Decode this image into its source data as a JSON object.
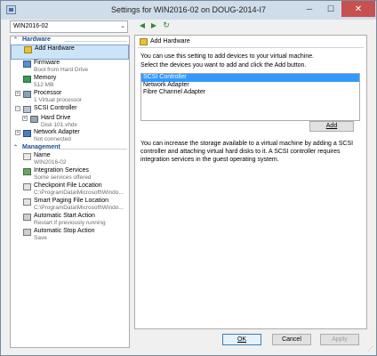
{
  "window": {
    "title": "Settings for WIN2016-02 on DOUG-2014-I7",
    "minimize_glyph": "─",
    "maximize_glyph": "☐",
    "close_glyph": "✕"
  },
  "vm_selector": {
    "value": "WIN2016-02",
    "chevron": "⌄"
  },
  "toolbar": {
    "back_glyph": "◀",
    "forward_glyph": "▶",
    "refresh_glyph": "↻"
  },
  "hardware": {
    "heading": "Hardware",
    "collapse_glyph": "⌃",
    "items": [
      {
        "name": "Add Hardware",
        "detail": ""
      },
      {
        "name": "Firmware",
        "detail": "Boot from Hard Drive"
      },
      {
        "name": "Memory",
        "detail": "512 MB"
      },
      {
        "name": "Processor",
        "detail": "1 Virtual processor"
      },
      {
        "name": "SCSI Controller",
        "detail": ""
      },
      {
        "name": "Hard Drive",
        "detail": "Disk 101.vhdx"
      },
      {
        "name": "Network Adapter",
        "detail": "Not connected"
      }
    ]
  },
  "management": {
    "heading": "Management",
    "collapse_glyph": "⌃",
    "items": [
      {
        "name": "Name",
        "detail": "WIN2016-02"
      },
      {
        "name": "Integration Services",
        "detail": "Some services offered"
      },
      {
        "name": "Checkpoint File Location",
        "detail": "C:\\ProgramData\\Microsoft\\Windo..."
      },
      {
        "name": "Smart Paging File Location",
        "detail": "C:\\ProgramData\\Microsoft\\Windo..."
      },
      {
        "name": "Automatic Start Action",
        "detail": "Restart if previously running"
      },
      {
        "name": "Automatic Stop Action",
        "detail": "Save"
      }
    ]
  },
  "tree_glyphs": {
    "expand_plus": "+",
    "expand_minus": "−"
  },
  "main": {
    "section_title": "Add Hardware",
    "intro": "You can use this setting to add devices to your virtual machine.",
    "instruction": "Select the devices you want to add and click the Add button.",
    "devices": [
      "SCSI Controller",
      "Network Adapter",
      "Fibre Channel Adapter"
    ],
    "selected_device": "SCSI Controller",
    "add_button": "Add",
    "footnote": "You can increase the storage available to a virtual machine by adding a SCSI controller and attaching virtual hard disks to it. A SCSI controller requires integration services in the guest operating system."
  },
  "buttons": {
    "ok": "OK",
    "cancel": "Cancel",
    "apply": "Apply"
  },
  "colors": {
    "accent": "#1b4e8c",
    "selection": "#3399ff",
    "close": "#c75050"
  }
}
